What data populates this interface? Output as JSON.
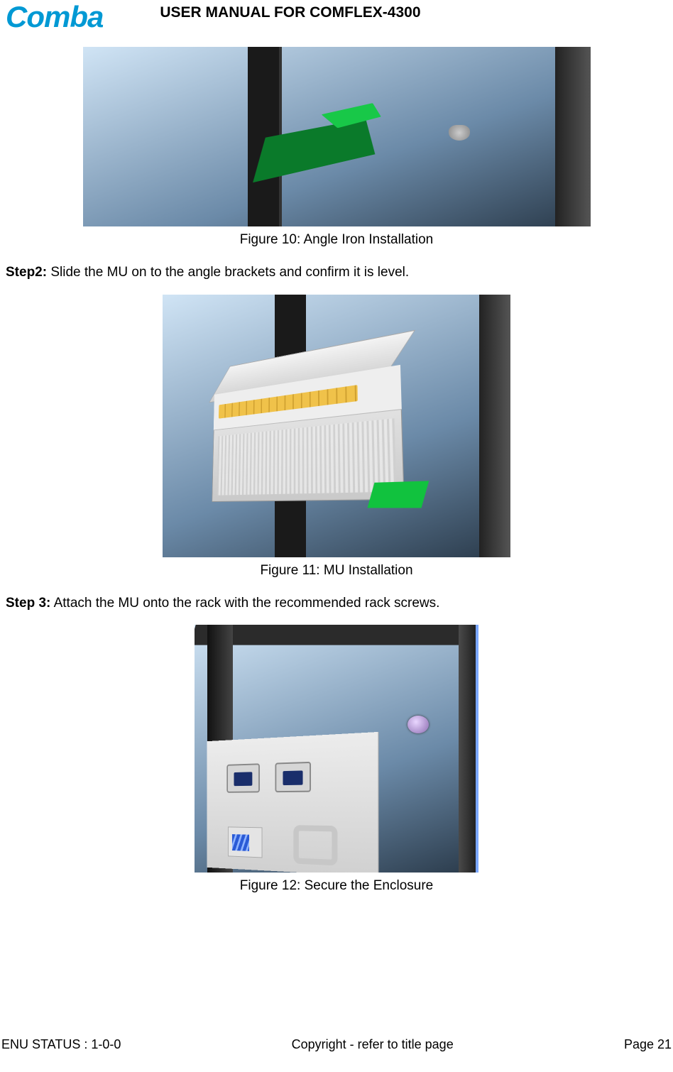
{
  "header": {
    "logo_text": "Comba",
    "title": "USER MANUAL FOR COMFLEX-4300"
  },
  "figures": {
    "f10": {
      "caption": "Figure 10: Angle Iron Installation"
    },
    "f11": {
      "caption": "Figure 11: MU Installation"
    },
    "f12": {
      "caption": "Figure 12: Secure the Enclosure"
    }
  },
  "steps": {
    "s2": {
      "label": "Step2:",
      "text": " Slide the MU on to the angle brackets and confirm it is level."
    },
    "s3": {
      "label": "Step 3:",
      "text": " Attach the MU onto the rack with the recommended rack screws."
    }
  },
  "footer": {
    "left": "ENU STATUS : 1-0-0",
    "center": "Copyright - refer to title page",
    "right": "Page 21"
  }
}
